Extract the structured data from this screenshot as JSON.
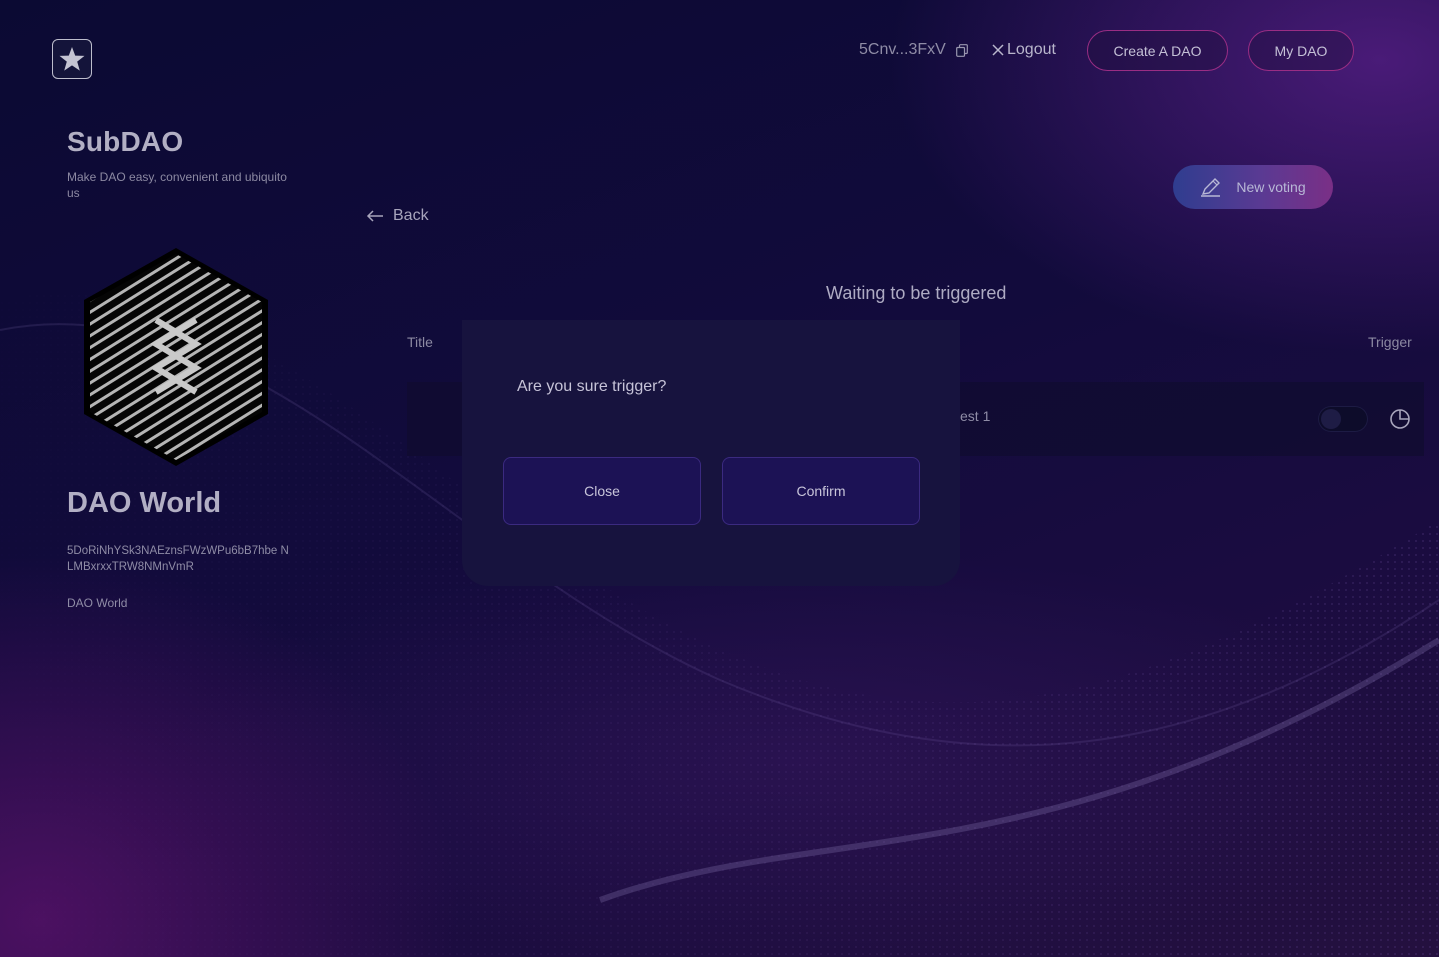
{
  "header": {
    "wallet_address": "5Cnv...3FxV",
    "logout_label": "Logout",
    "create_dao_label": "Create A DAO",
    "my_dao_label": "My DAO"
  },
  "sidebar": {
    "app_title": "SubDAO",
    "app_subtitle": "Make DAO easy, convenient and ubiquito us",
    "dao_name": "DAO World",
    "dao_address": "5DoRiNhYSk3NAEznsFWzWPu6bB7hbe NLMBxrxxTRW8NMnVmR",
    "dao_description": "DAO World"
  },
  "main": {
    "back_label": "Back",
    "new_voting_label": "New voting",
    "section_title": "Waiting to be triggered",
    "columns": {
      "title": "Title",
      "trigger": "Trigger"
    },
    "rows": [
      {
        "title": "est 1",
        "toggle_on": false
      }
    ]
  },
  "modal": {
    "question": "Are you sure trigger?",
    "close_label": "Close",
    "confirm_label": "Confirm"
  },
  "colors": {
    "accent_border": "#9a2d84",
    "modal_bg": "#17133e",
    "button_bg": "#1c1255"
  },
  "icons": [
    "star-logo-icon",
    "copy-icon",
    "close-x-icon",
    "arrow-left-icon",
    "pen-icon",
    "pie-chart-icon"
  ]
}
